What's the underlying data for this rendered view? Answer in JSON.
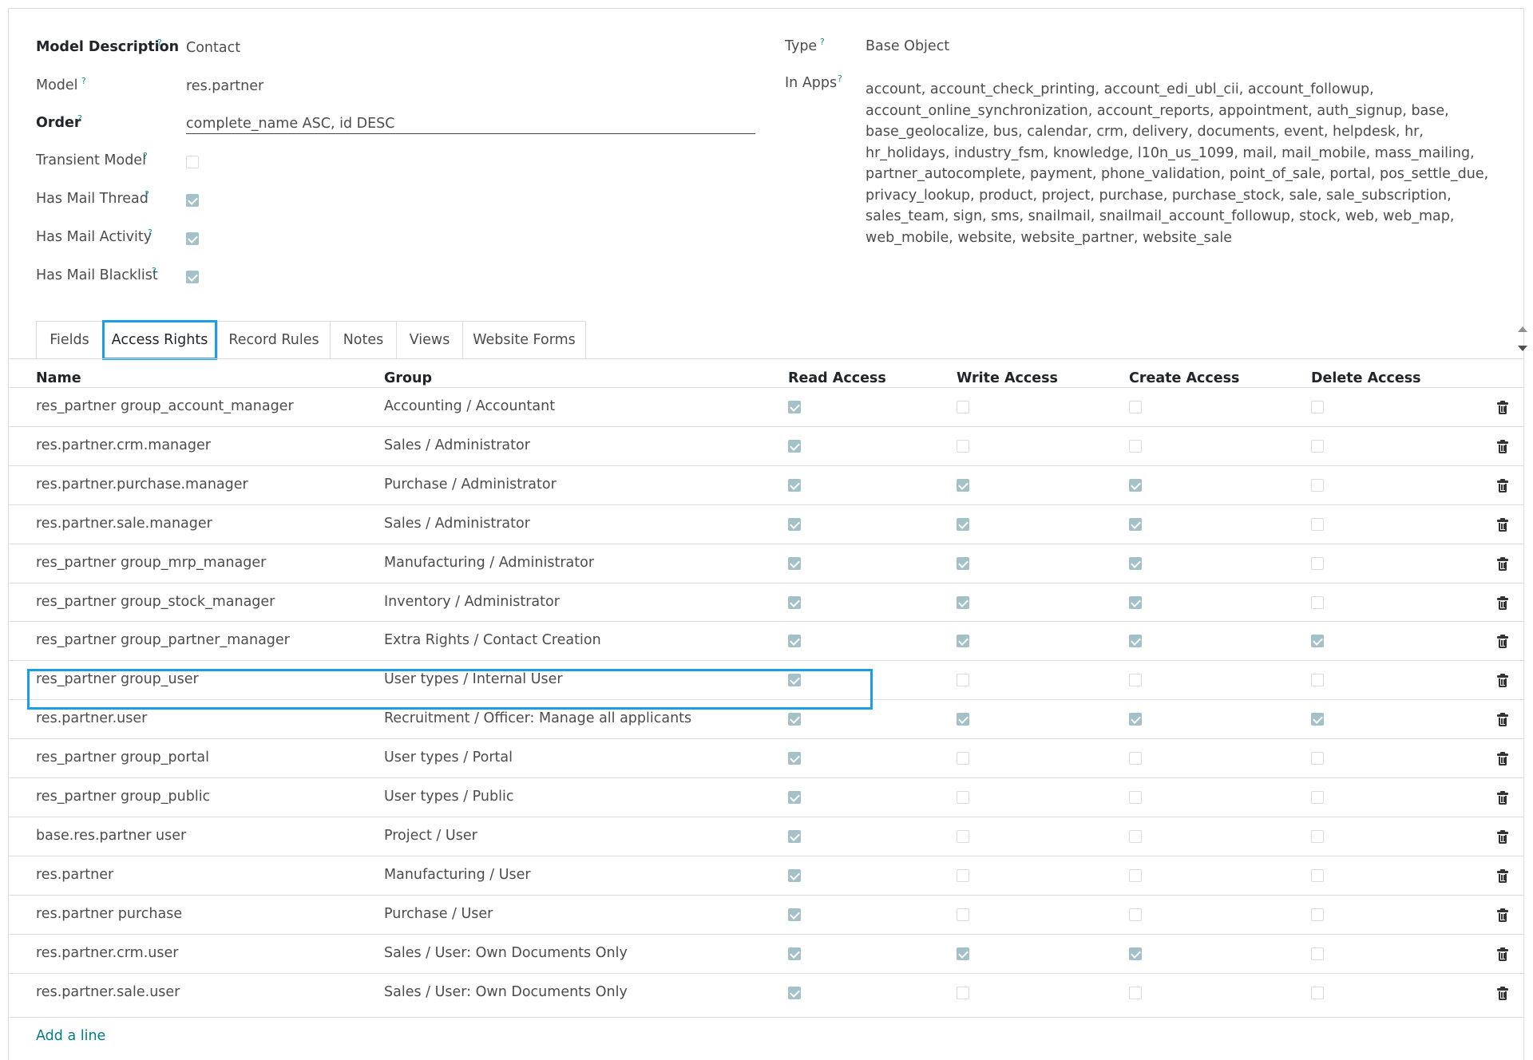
{
  "fields": {
    "model_description": {
      "label": "Model Description",
      "value": "Contact"
    },
    "model": {
      "label": "Model",
      "value": "res.partner"
    },
    "order": {
      "label": "Order",
      "value": "complete_name ASC, id DESC"
    },
    "transient_model": {
      "label": "Transient Model",
      "checked": false
    },
    "has_mail_thread": {
      "label": "Has Mail Thread",
      "checked": true
    },
    "has_mail_activity": {
      "label": "Has Mail Activity",
      "checked": true
    },
    "has_mail_blacklist": {
      "label": "Has Mail Blacklist",
      "checked": true
    },
    "type": {
      "label": "Type",
      "value": "Base Object"
    },
    "in_apps": {
      "label": "In Apps",
      "value": "account, account_check_printing, account_edi_ubl_cii, account_followup, account_online_synchronization, account_reports, appointment, auth_signup, base, base_geolocalize, bus, calendar, crm, delivery, documents, event, helpdesk, hr, hr_holidays, industry_fsm, knowledge, l10n_us_1099, mail, mail_mobile, mass_mailing, partner_autocomplete, payment, phone_validation, point_of_sale, portal, pos_settle_due, privacy_lookup, product, project, purchase, purchase_stock, sale, sale_subscription, sales_team, sign, sms, snailmail, snailmail_account_followup, stock, web, web_map, web_mobile, website, website_partner, website_sale"
    }
  },
  "help_mark": "?",
  "tabs": [
    {
      "label": "Fields",
      "active": false
    },
    {
      "label": "Access Rights",
      "active": true
    },
    {
      "label": "Record Rules",
      "active": false
    },
    {
      "label": "Notes",
      "active": false
    },
    {
      "label": "Views",
      "active": false
    },
    {
      "label": "Website Forms",
      "active": false
    }
  ],
  "table": {
    "headers": [
      "Name",
      "Group",
      "Read Access",
      "Write Access",
      "Create Access",
      "Delete Access"
    ],
    "rows": [
      {
        "name": "res_partner group_account_manager",
        "group": "Accounting / Accountant",
        "read": true,
        "write": false,
        "create": false,
        "delete": false
      },
      {
        "name": "res.partner.crm.manager",
        "group": "Sales / Administrator",
        "read": true,
        "write": false,
        "create": false,
        "delete": false
      },
      {
        "name": "res.partner.purchase.manager",
        "group": "Purchase / Administrator",
        "read": true,
        "write": true,
        "create": true,
        "delete": false
      },
      {
        "name": "res.partner.sale.manager",
        "group": "Sales / Administrator",
        "read": true,
        "write": true,
        "create": true,
        "delete": false
      },
      {
        "name": "res_partner group_mrp_manager",
        "group": "Manufacturing / Administrator",
        "read": true,
        "write": true,
        "create": true,
        "delete": false
      },
      {
        "name": "res_partner group_stock_manager",
        "group": "Inventory / Administrator",
        "read": true,
        "write": true,
        "create": true,
        "delete": false
      },
      {
        "name": "res_partner group_partner_manager",
        "group": "Extra Rights / Contact Creation",
        "read": true,
        "write": true,
        "create": true,
        "delete": true
      },
      {
        "name": "res_partner group_user",
        "group": "User types / Internal User",
        "read": true,
        "write": false,
        "create": false,
        "delete": false,
        "highlighted": true
      },
      {
        "name": "res.partner.user",
        "group": "Recruitment / Officer: Manage all applicants",
        "read": true,
        "write": true,
        "create": true,
        "delete": true
      },
      {
        "name": "res_partner group_portal",
        "group": "User types / Portal",
        "read": true,
        "write": false,
        "create": false,
        "delete": false
      },
      {
        "name": "res_partner group_public",
        "group": "User types / Public",
        "read": true,
        "write": false,
        "create": false,
        "delete": false
      },
      {
        "name": "base.res.partner user",
        "group": "Project / User",
        "read": true,
        "write": false,
        "create": false,
        "delete": false
      },
      {
        "name": "res.partner",
        "group": "Manufacturing / User",
        "read": true,
        "write": false,
        "create": false,
        "delete": false
      },
      {
        "name": "res.partner purchase",
        "group": "Purchase / User",
        "read": true,
        "write": false,
        "create": false,
        "delete": false
      },
      {
        "name": "res.partner.crm.user",
        "group": "Sales / User: Own Documents Only",
        "read": true,
        "write": true,
        "create": true,
        "delete": false
      },
      {
        "name": "res.partner.sale.user",
        "group": "Sales / User: Own Documents Only",
        "read": true,
        "write": false,
        "create": false,
        "delete": false
      }
    ],
    "add_line_label": "Add a line"
  },
  "colors": {
    "accent": "#1a9ee6",
    "checkbox_on": "#a3c1c6",
    "link": "#017e84",
    "help": "#0e8f9b"
  },
  "icons": {
    "delete": "trash-icon",
    "scroll_up": "caret-up-icon",
    "scroll_down": "caret-down-icon"
  }
}
